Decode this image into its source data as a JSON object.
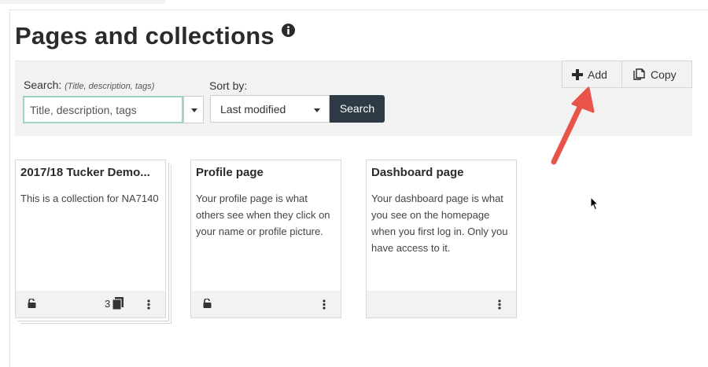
{
  "header": {
    "title": "Pages and collections",
    "info_icon": "info-circle-icon"
  },
  "toolbar": {
    "search_label": "Search:",
    "search_hint": "(Title, description, tags)",
    "search_value": "Title, description, tags",
    "sort_label": "Sort by:",
    "sort_value": "Last modified",
    "search_button": "Search"
  },
  "actions": {
    "add_label": "Add",
    "copy_label": "Copy"
  },
  "cards": [
    {
      "title": "2017/18 Tucker Demo...",
      "description": "This is a collection for NA7140",
      "count": "3",
      "locked": true
    },
    {
      "title": "Profile page",
      "description": "Your profile page is what others see when they click on your name or profile picture.",
      "locked": true
    },
    {
      "title": "Dashboard page",
      "description": "Your dashboard page is what you see on the homepage when you first log in. Only you have access to it.",
      "locked": false
    }
  ],
  "colors": {
    "accent_dark": "#2e3a45",
    "search_border": "#9fd3c7",
    "arrow": "#e8534a"
  }
}
